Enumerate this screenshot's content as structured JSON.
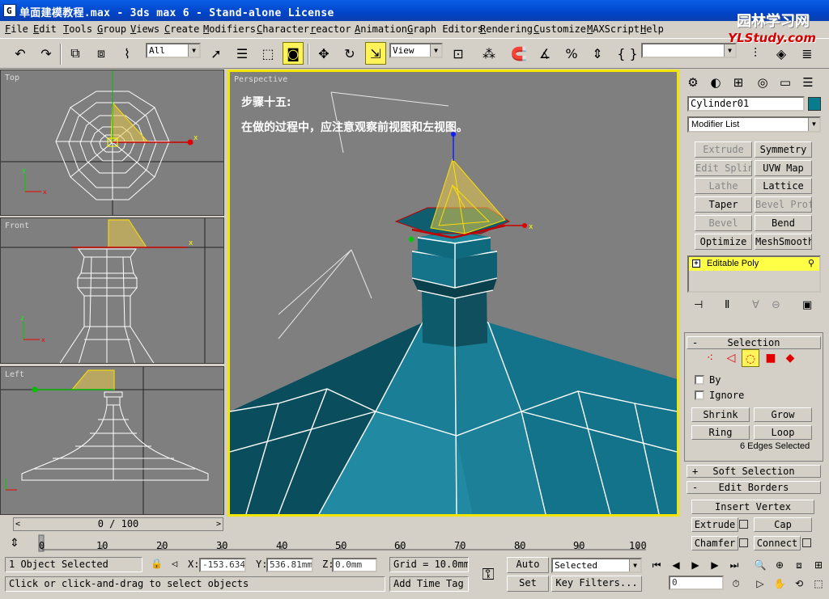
{
  "window": {
    "title": "单面建模教程.max - 3ds max 6 - Stand-alone License",
    "app_icon_letter": "G"
  },
  "watermark": {
    "line1": "园林学习网",
    "line2": "YLStudy.com"
  },
  "menu": [
    "File",
    "Edit",
    "Tools",
    "Group",
    "Views",
    "Create",
    "Modifiers",
    "Character",
    "reactor",
    "Animation",
    "Graph Editors",
    "Rendering",
    "Customize",
    "MAXScript",
    "Help"
  ],
  "toolbar": {
    "selection_filter": "All",
    "reference_coord": "View",
    "named_selection": ""
  },
  "viewports": {
    "top": {
      "label": "Top"
    },
    "front": {
      "label": "Front"
    },
    "left": {
      "label": "Left"
    },
    "perspective": {
      "label": "Perspective"
    }
  },
  "annotation": {
    "heading": "步骤十五:",
    "body": "在做的过程中，应注意观察前视图和左视图。"
  },
  "command_panel": {
    "object_name": "Cylinder01",
    "object_color": "#067c8c",
    "modifier_list": "Modifier List",
    "modifier_buttons": [
      {
        "label": "Extrude",
        "enabled": false
      },
      {
        "label": "Symmetry",
        "enabled": true
      },
      {
        "label": "Edit Spline",
        "enabled": false
      },
      {
        "label": "UVW Map",
        "enabled": true
      },
      {
        "label": "Lathe",
        "enabled": false
      },
      {
        "label": "Lattice",
        "enabled": true
      },
      {
        "label": "Taper",
        "enabled": true
      },
      {
        "label": "Bevel Profile",
        "enabled": false
      },
      {
        "label": "Bevel",
        "enabled": false
      },
      {
        "label": "Bend",
        "enabled": true
      },
      {
        "label": "Optimize",
        "enabled": true
      },
      {
        "label": "MeshSmooth",
        "enabled": true
      }
    ],
    "stack_item": "Editable Poly",
    "selection_rollout": "Selection",
    "by_label": "By",
    "ignore_label": "Ignore",
    "shrink": "Shrink",
    "grow": "Grow",
    "ring": "Ring",
    "loop": "Loop",
    "selected_count": "6 Edges Selected",
    "soft_selection": "Soft Selection",
    "edit_borders": "Edit Borders",
    "insert_vertex": "Insert Vertex",
    "extrude": "Extrude",
    "cap": "Cap",
    "chamfer": "Chamfer",
    "connect": "Connect"
  },
  "timeline": {
    "slider_text": "0 / 100",
    "ticks": [
      "0",
      "10",
      "20",
      "30",
      "40",
      "50",
      "60",
      "70",
      "80",
      "90",
      "100"
    ]
  },
  "status": {
    "selected": "1 Object Selected",
    "prompt": "Click or click-and-drag to select objects",
    "x_label": "X:",
    "x_value": "-153.634",
    "y_label": "Y:",
    "y_value": "536.81mm",
    "z_label": "Z:",
    "z_value": "0.0mm",
    "grid": "Grid = 10.0mm",
    "add_time_tag": "Add Time Tag",
    "auto_key": "Auto Key",
    "set_key": "Set Key",
    "key_mode": "Selected",
    "key_filters": "Key Filters...",
    "frame": "0"
  }
}
